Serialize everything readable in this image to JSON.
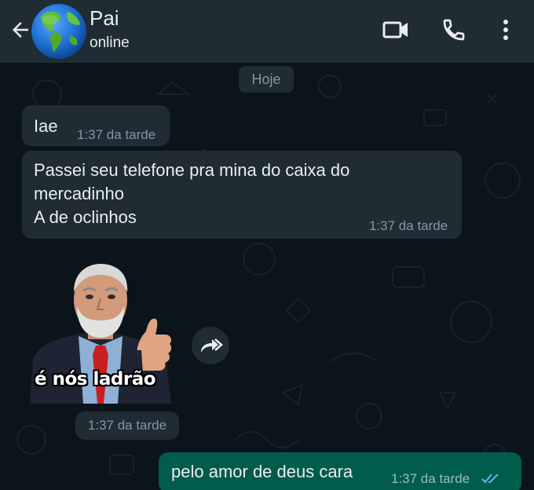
{
  "header": {
    "back_icon": "arrow-left-icon",
    "contact_name": "Pai",
    "contact_status": "online",
    "avatar_icon": "globe-icon",
    "video_call_icon": "video-camera-icon",
    "voice_call_icon": "phone-icon",
    "menu_icon": "more-vertical-icon"
  },
  "chat": {
    "date_chip": "Hoje",
    "messages": [
      {
        "direction": "in",
        "text": "Iae",
        "time": "1:37 da tarde"
      },
      {
        "direction": "in",
        "lines": [
          "Passei seu telefone pra mina do caixa do",
          "mercadinho",
          "A de oclinhos"
        ],
        "time": "1:37 da tarde"
      },
      {
        "direction": "in",
        "type": "sticker",
        "caption": "é nós ladrão",
        "time": "1:37 da tarde",
        "forward_icon": "forward-icon"
      },
      {
        "direction": "out",
        "text": "pelo amor de deus cara",
        "time": "1:37 da tarde",
        "status_icon": "double-check-read-icon"
      }
    ]
  },
  "colors": {
    "header_bg": "#1f2c34",
    "chat_bg": "#0b141a",
    "incoming_bubble": "#1f2c34",
    "outgoing_bubble": "#005c4b",
    "read_check": "#53bdeb"
  }
}
